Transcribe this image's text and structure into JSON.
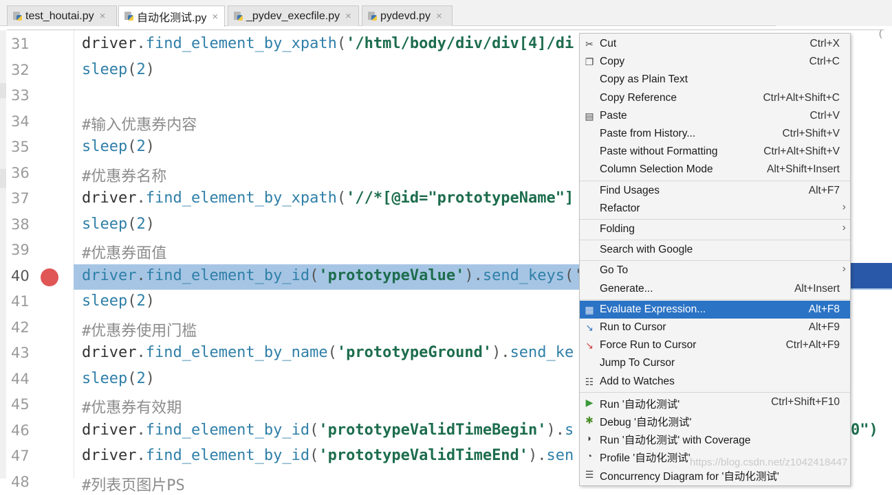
{
  "tabs": [
    {
      "label": "test_houtai.py",
      "close": "×"
    },
    {
      "label": "自动化测试.py",
      "close": "×"
    },
    {
      "label": "_pydev_execfile.py",
      "close": "×"
    },
    {
      "label": "pydevd.py",
      "close": "×"
    }
  ],
  "top_right_mark": "(",
  "editor": {
    "current_line": 40,
    "breakpoint_line": 40,
    "lines": [
      {
        "num": "31",
        "parts": [
          [
            "kw",
            "driver"
          ],
          [
            "p",
            "."
          ],
          [
            "m",
            "find_element_by_xpath"
          ],
          [
            "p",
            "("
          ],
          [
            "s",
            "'/html/body/div/div[4]/di"
          ]
        ]
      },
      {
        "num": "32",
        "parts": [
          [
            "n",
            "sleep"
          ],
          [
            "p",
            "("
          ],
          [
            "n",
            "2"
          ],
          [
            "p",
            ")"
          ]
        ]
      },
      {
        "num": "33",
        "parts": []
      },
      {
        "num": "34",
        "parts": [
          [
            "c",
            "#输入优惠券内容"
          ]
        ]
      },
      {
        "num": "35",
        "parts": [
          [
            "n",
            "sleep"
          ],
          [
            "p",
            "("
          ],
          [
            "n",
            "2"
          ],
          [
            "p",
            ")"
          ]
        ]
      },
      {
        "num": "36",
        "parts": [
          [
            "c",
            "#优惠券名称"
          ]
        ]
      },
      {
        "num": "37",
        "parts": [
          [
            "kw",
            "driver"
          ],
          [
            "p",
            "."
          ],
          [
            "m",
            "find_element_by_xpath"
          ],
          [
            "p",
            "("
          ],
          [
            "s",
            "'//*[@id=\"prototypeName\"]"
          ]
        ]
      },
      {
        "num": "38",
        "parts": [
          [
            "n",
            "sleep"
          ],
          [
            "p",
            "("
          ],
          [
            "n",
            "2"
          ],
          [
            "p",
            ")"
          ]
        ]
      },
      {
        "num": "39",
        "parts": [
          [
            "c",
            "#优惠券面值"
          ]
        ]
      },
      {
        "num": "40",
        "parts": [
          [
            "m",
            "driver"
          ],
          [
            "p",
            "."
          ],
          [
            "m",
            "find_element_by_id"
          ],
          [
            "p",
            "("
          ],
          [
            "s",
            "'prototypeValue'"
          ],
          [
            "p",
            ")."
          ],
          [
            "m",
            "send_keys"
          ],
          [
            "p",
            "('"
          ]
        ]
      },
      {
        "num": "41",
        "parts": [
          [
            "n",
            "sleep"
          ],
          [
            "p",
            "("
          ],
          [
            "n",
            "2"
          ],
          [
            "p",
            ")"
          ]
        ]
      },
      {
        "num": "42",
        "parts": [
          [
            "c",
            "#优惠券使用门槛"
          ]
        ]
      },
      {
        "num": "43",
        "parts": [
          [
            "kw",
            "driver"
          ],
          [
            "p",
            "."
          ],
          [
            "m",
            "find_element_by_name"
          ],
          [
            "p",
            "("
          ],
          [
            "s",
            "'prototypeGround'"
          ],
          [
            "p",
            ")."
          ],
          [
            "m",
            "send_ke"
          ]
        ]
      },
      {
        "num": "44",
        "parts": [
          [
            "n",
            "sleep"
          ],
          [
            "p",
            "("
          ],
          [
            "n",
            "2"
          ],
          [
            "p",
            ")"
          ]
        ]
      },
      {
        "num": "45",
        "parts": [
          [
            "c",
            "#优惠券有效期"
          ]
        ]
      },
      {
        "num": "46",
        "parts": [
          [
            "kw",
            "driver"
          ],
          [
            "p",
            "."
          ],
          [
            "m",
            "find_element_by_id"
          ],
          [
            "p",
            "("
          ],
          [
            "s",
            "'prototypeValidTimeBegin'"
          ],
          [
            "p",
            ")."
          ],
          [
            "m",
            "s"
          ]
        ]
      },
      {
        "num": "47",
        "parts": [
          [
            "kw",
            "driver"
          ],
          [
            "p",
            "."
          ],
          [
            "m",
            "find_element_by_id"
          ],
          [
            "p",
            "("
          ],
          [
            "s",
            "'prototypeValidTimeEnd'"
          ],
          [
            "p",
            ")."
          ],
          [
            "m",
            "sen"
          ]
        ]
      },
      {
        "num": "48",
        "parts": [
          [
            "c",
            "#列表页图片PS"
          ]
        ]
      }
    ],
    "overflow_right_46": "0\")"
  },
  "context_menu": {
    "selected": "Evaluate Expression...",
    "items": [
      {
        "icon": "scissors-icon",
        "glyph": "✂",
        "label": "Cut",
        "shortcut": "Ctrl+X"
      },
      {
        "icon": "copy-icon",
        "glyph": "❐",
        "label": "Copy",
        "shortcut": "Ctrl+C"
      },
      {
        "icon": "",
        "glyph": "",
        "label": "Copy as Plain Text",
        "shortcut": ""
      },
      {
        "icon": "",
        "glyph": "",
        "label": "Copy Reference",
        "shortcut": "Ctrl+Alt+Shift+C"
      },
      {
        "icon": "paste-icon",
        "glyph": "▤",
        "label": "Paste",
        "shortcut": "Ctrl+V"
      },
      {
        "icon": "",
        "glyph": "",
        "label": "Paste from History...",
        "shortcut": "Ctrl+Shift+V"
      },
      {
        "icon": "",
        "glyph": "",
        "label": "Paste without Formatting",
        "shortcut": "Ctrl+Alt+Shift+V"
      },
      {
        "icon": "",
        "glyph": "",
        "label": "Column Selection Mode",
        "shortcut": "Alt+Shift+Insert"
      },
      {
        "sep": true
      },
      {
        "icon": "",
        "glyph": "",
        "label": "Find Usages",
        "shortcut": "Alt+F7"
      },
      {
        "icon": "",
        "glyph": "",
        "label": "Refactor",
        "shortcut": "",
        "submenu": "›"
      },
      {
        "sep": true
      },
      {
        "icon": "",
        "glyph": "",
        "label": "Folding",
        "shortcut": "",
        "submenu": "›"
      },
      {
        "sep": true
      },
      {
        "icon": "",
        "glyph": "",
        "label": "Search with Google",
        "shortcut": ""
      },
      {
        "sep": true
      },
      {
        "icon": "",
        "glyph": "",
        "label": "Go To",
        "shortcut": "",
        "submenu": "›"
      },
      {
        "icon": "",
        "glyph": "",
        "label": "Generate...",
        "shortcut": "Alt+Insert"
      },
      {
        "sep": true
      },
      {
        "icon": "calculator-icon",
        "glyph": "▦",
        "label": "Evaluate Expression...",
        "shortcut": "Alt+F8"
      },
      {
        "icon": "run-to-cursor-icon",
        "glyph": "↘",
        "label": "Run to Cursor",
        "shortcut": "Alt+F9"
      },
      {
        "icon": "force-run-to-cursor-icon",
        "glyph": "↘",
        "label": "Force Run to Cursor",
        "shortcut": "Ctrl+Alt+F9"
      },
      {
        "icon": "",
        "glyph": "",
        "label": "Jump To Cursor",
        "shortcut": ""
      },
      {
        "icon": "watches-icon",
        "glyph": "☷",
        "label": "Add to Watches",
        "shortcut": ""
      },
      {
        "sep": true
      },
      {
        "icon": "run-icon",
        "glyph": "▶",
        "label": "Run '自动化测试'",
        "shortcut": "Ctrl+Shift+F10"
      },
      {
        "icon": "debug-icon",
        "glyph": "✱",
        "label": "Debug '自动化测试'",
        "shortcut": ""
      },
      {
        "icon": "coverage-icon",
        "glyph": "◗",
        "label": "Run '自动化测试' with Coverage",
        "shortcut": ""
      },
      {
        "icon": "profile-icon",
        "glyph": "◔",
        "label": "Profile '自动化测试'",
        "shortcut": ""
      },
      {
        "icon": "diagram-icon",
        "glyph": "☰",
        "label": "Concurrency Diagram for '自动化测试'",
        "shortcut": ""
      }
    ]
  },
  "watermark": "https://blog.csdn.net/z1042418447"
}
